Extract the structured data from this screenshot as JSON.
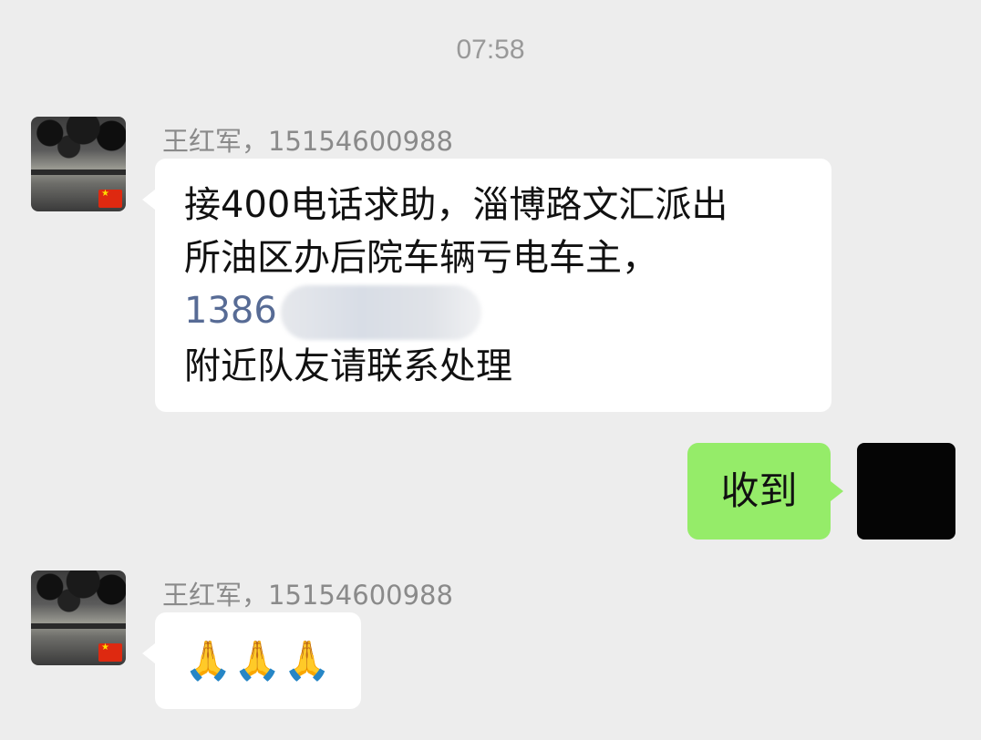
{
  "timestamp": "07:58",
  "messages": [
    {
      "sender": "王红军，15154600988",
      "lines": [
        "接400电话求助，淄博路文汇派出",
        "所油区办后院车辆亏电车主，",
        "附近队友请联系处理"
      ],
      "phone_visible": "1386"
    },
    {
      "sender": "self",
      "text": "收到"
    },
    {
      "sender": "王红军，15154600988",
      "text": "🙏🙏🙏"
    }
  ],
  "avatars": {
    "other": "landscape-avatar-with-flag",
    "self": "black-avatar"
  },
  "colors": {
    "background": "#ededed",
    "bubble_in": "#ffffff",
    "bubble_out": "#95ec69",
    "link": "#576b95"
  }
}
